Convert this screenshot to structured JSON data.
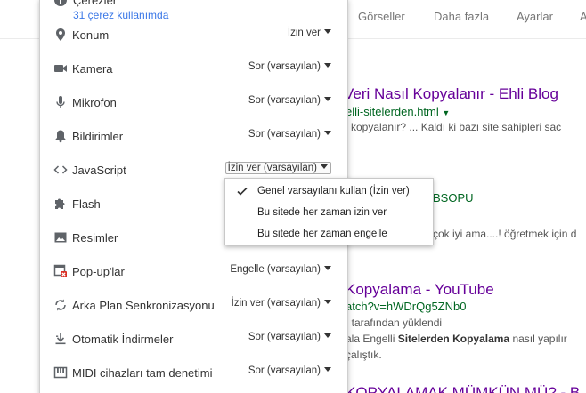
{
  "background": {
    "tabs": [
      "Görseller",
      "Daha fazla",
      "Ayarlar",
      "A"
    ],
    "results": [
      {
        "title": "Veri Nasıl Kopyalanır - Ehli Blog",
        "url": "elli-sitelerden.html",
        "snippet": "i kopyalanır? ... Kaldı ki bazı site sahipleri sac",
        "snippet2": "."
      },
      {
        "title": "BSOPU",
        "snippet": "çok iyi ama....! öğretmek için d"
      },
      {
        "title": "Kopyalama - YouTube",
        "url": "atch?v=hWDrQg5ZNb0",
        "snippet": "ı tarafından yüklendi",
        "snippet2": "ala Engelli Sitelerden Kopyalama nasıl yapılır",
        "snippet3": "çalıştık."
      },
      {
        "title": "KOPYALAMAK MÜMKÜN MÜ? - B"
      }
    ]
  },
  "panel": {
    "cookies": {
      "title": "Çerezler",
      "link": "31 çerez kullanımda"
    },
    "permissions": [
      {
        "label": "Konum",
        "value": "İzin ver",
        "icon": "location-icon"
      },
      {
        "label": "Kamera",
        "value": "Sor (varsayılan)",
        "icon": "camera-icon"
      },
      {
        "label": "Mikrofon",
        "value": "Sor (varsayılan)",
        "icon": "microphone-icon"
      },
      {
        "label": "Bildirimler",
        "value": "Sor (varsayılan)",
        "icon": "bell-icon"
      },
      {
        "label": "JavaScript",
        "value": "İzin ver (varsayılan)",
        "icon": "code-icon"
      },
      {
        "label": "Flash",
        "value": "",
        "icon": "puzzle-icon"
      },
      {
        "label": "Resimler",
        "value": "",
        "icon": "image-icon"
      },
      {
        "label": "Pop-up'lar",
        "value": "Engelle (varsayılan)",
        "icon": "popup-blocked-icon"
      },
      {
        "label": "Arka Plan Senkronizasyonu",
        "value": "İzin ver (varsayılan)",
        "icon": "sync-icon"
      },
      {
        "label": "Otomatik İndirmeler",
        "value": "Sor (varsayılan)",
        "icon": "download-icon"
      },
      {
        "label": "MIDI cihazları tam denetimi",
        "value": "Sor (varsayılan)",
        "icon": "piano-icon"
      }
    ]
  },
  "dropdown": {
    "options": [
      "Genel varsayılanı kullan (İzin ver)",
      "Bu sitede her zaman izin ver",
      "Bu sitede her zaman engelle"
    ],
    "selected_index": 0
  }
}
